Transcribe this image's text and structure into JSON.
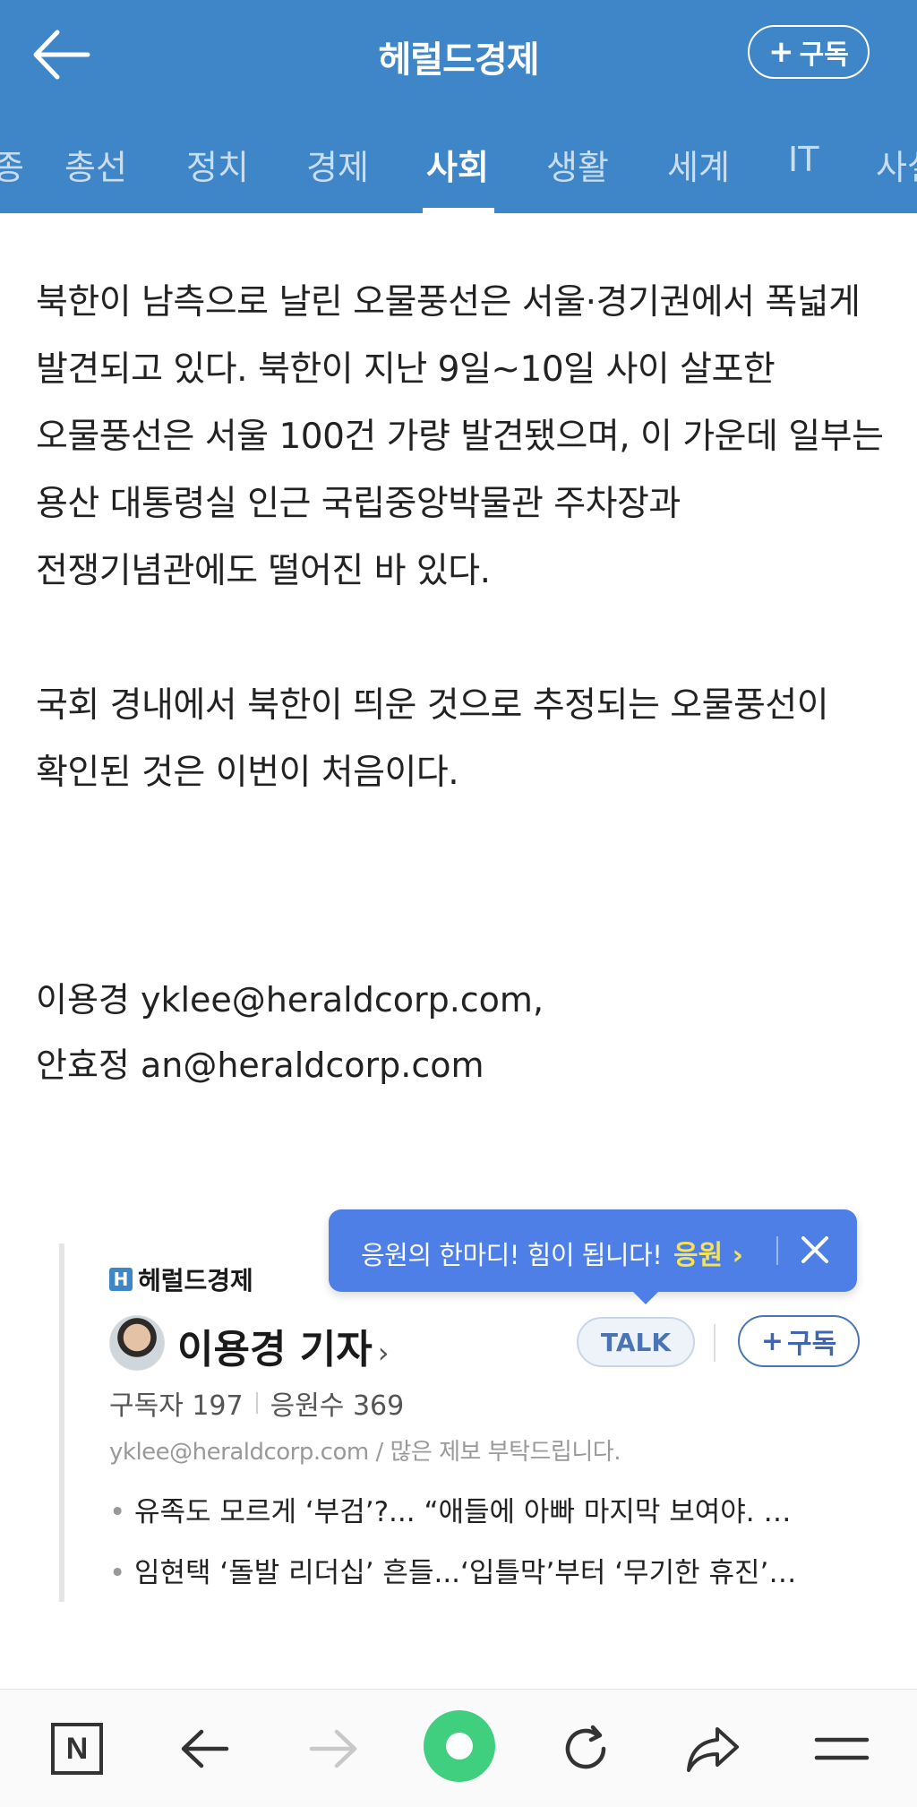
{
  "header": {
    "title": "헤럴드경제",
    "subscribe_label": "구독",
    "colors": {
      "background": "#3f86c8",
      "text": "#ffffff"
    }
  },
  "tabs": [
    {
      "label": "종",
      "active": false
    },
    {
      "label": "총선",
      "active": false
    },
    {
      "label": "정치",
      "active": false
    },
    {
      "label": "경제",
      "active": false
    },
    {
      "label": "사회",
      "active": true
    },
    {
      "label": "생활",
      "active": false
    },
    {
      "label": "세계",
      "active": false
    },
    {
      "label": "IT",
      "active": false
    },
    {
      "label": "사설",
      "active": false
    }
  ],
  "article": {
    "paragraphs": [
      "북한이 남측으로 날린 오물풍선은 서울·경기권에서 폭넓게 발견되고 있다. 북한이 지난 9일~10일 사이 살포한 오물풍선은 서울 100건 가량 발견됐으며, 이 가운데 일부는 용산 대통령실 인근 국립중앙박물관 주차장과 전쟁기념관에도 떨어진 바 있다.",
      "국회 경내에서 북한이 띄운 것으로 추정되는 오물풍선이 확인된 것은 이번이 처음이다."
    ],
    "bylines": [
      "이용경 yklee@heraldcorp.com,",
      "안효정 an@heraldcorp.com"
    ]
  },
  "reporter_card": {
    "outlet": "헤럴드경제",
    "name": "이용경 기자",
    "talk_label": "TALK",
    "subscribe_label": "구독",
    "subscribers_label": "구독자 197",
    "cheers_label": "응원수 369",
    "email_line": "yklee@heraldcorp.com / 많은 제보 부탁드립니다.",
    "related_articles": [
      "유족도 모르게 ‘부검’?... “애들에 아빠 마지막 보여야. …",
      "임현택 ‘돌발 리더십’ 흔들...‘입틀막’부터 ‘무기한 휴진’…"
    ]
  },
  "cheer_tooltip": {
    "text": "응원의 한마디! 힘이 됩니다!",
    "cta": "응원",
    "colors": {
      "background": "#4d7fe6",
      "cta": "#f4e25a"
    }
  },
  "bottom_bar": {
    "home_label": "N",
    "icons": [
      "naver-home-icon",
      "back-arrow-icon",
      "forward-arrow-icon",
      "green-dot-icon",
      "refresh-icon",
      "share-icon",
      "menu-icon"
    ]
  }
}
